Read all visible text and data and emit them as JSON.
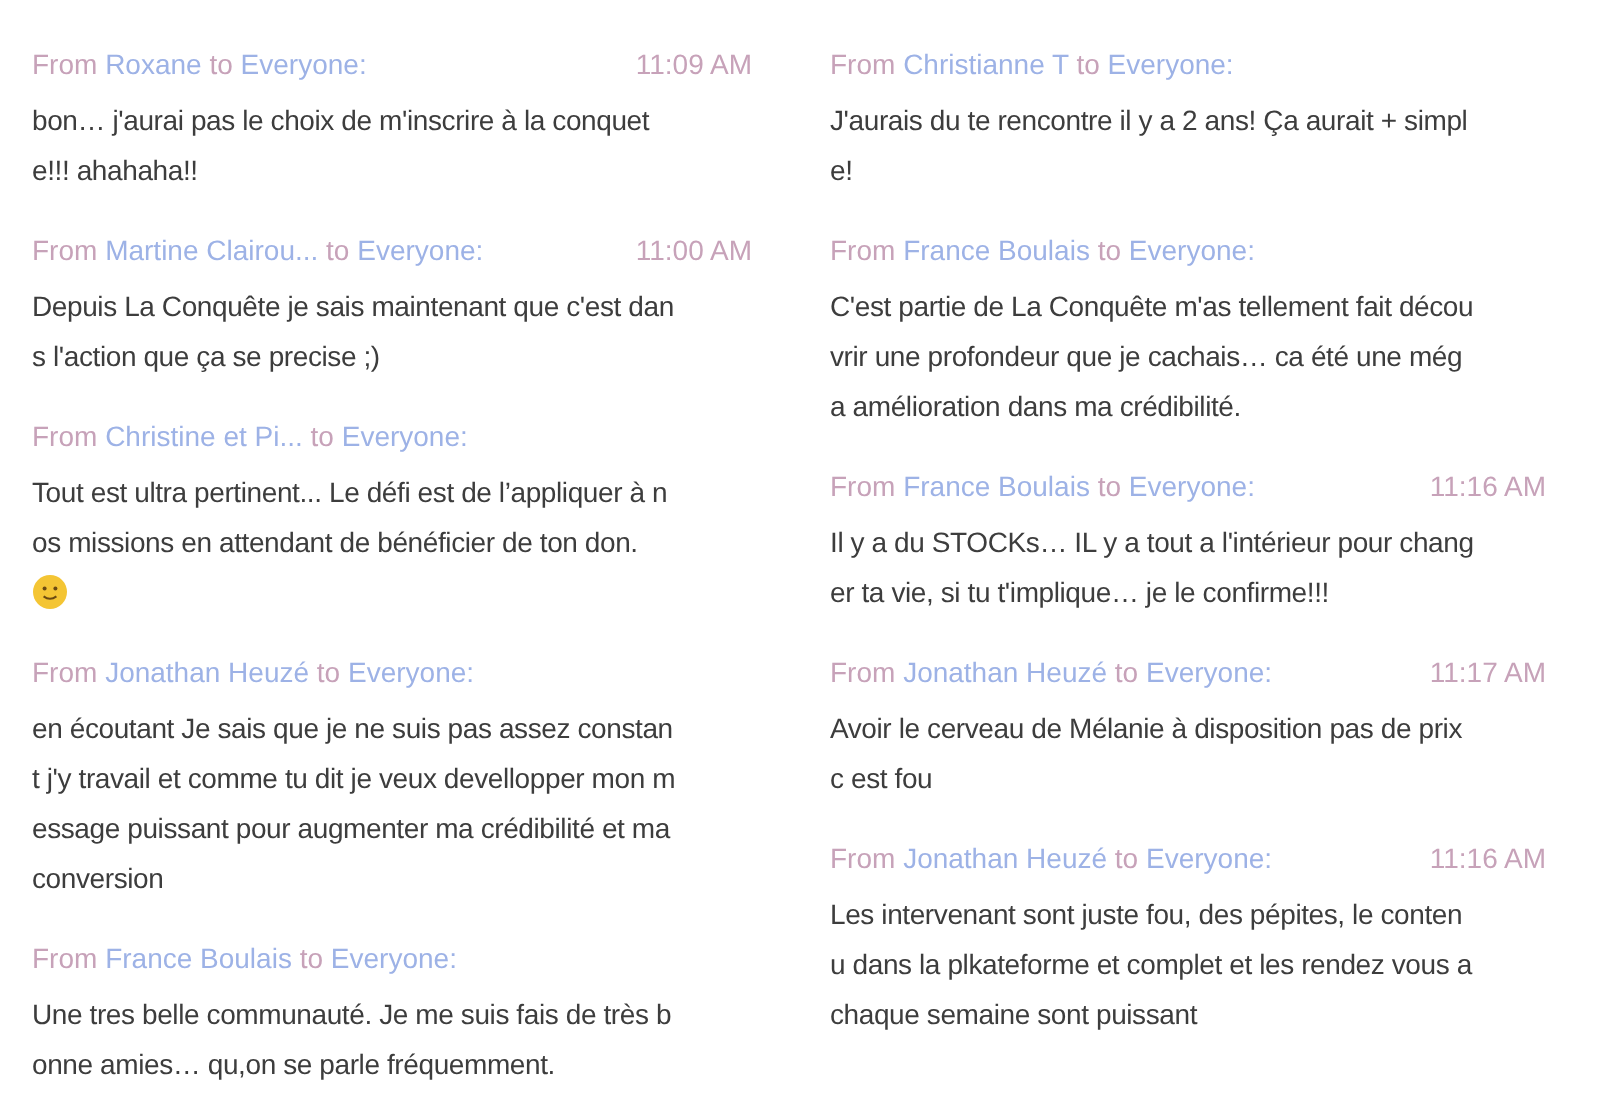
{
  "columns": [
    {
      "messages": [
        {
          "header": {
            "from_label": "From",
            "sender": "Roxane",
            "to_label": "to",
            "recipient": "Everyone:"
          },
          "time": "11:09 AM",
          "lines": [
            "bon… j'aurai pas le choix de m'inscrire à la conquet",
            "e!!! ahahaha!!"
          ]
        },
        {
          "header": {
            "from_label": "From",
            "sender": "Martine Clairou...",
            "to_label": "to",
            "recipient": "Everyone:"
          },
          "time": "11:00 AM",
          "lines": [
            "Depuis La Conquête je sais maintenant que c'est dan",
            "s l'action que ça se precise ;)"
          ]
        },
        {
          "header": {
            "from_label": "From",
            "sender": "Christine et Pi...",
            "to_label": "to",
            "recipient": "Everyone:"
          },
          "lines": [
            "Tout est ultra pertinent... Le défi est de l’appliquer à n",
            "os missions en attendant de bénéficier de ton don."
          ],
          "has_emoji": true
        },
        {
          "header": {
            "from_label": "From",
            "sender": "Jonathan Heuzé",
            "to_label": "to",
            "recipient": "Everyone:"
          },
          "lines": [
            "en écoutant Je sais que je ne suis pas assez constan",
            "t j'y travail et comme tu dit je veux devellopper mon m",
            "essage puissant pour augmenter ma crédibilité et ma",
            "conversion"
          ]
        },
        {
          "header": {
            "from_label": "From",
            "sender": "France Boulais",
            "to_label": "to",
            "recipient": "Everyone:"
          },
          "lines": [
            "Une tres belle communauté. Je me suis fais de très b",
            "onne amies… qu,on se parle fréquemment."
          ]
        }
      ]
    },
    {
      "messages": [
        {
          "header": {
            "from_label": "From",
            "sender": "Christianne T",
            "to_label": "to",
            "recipient": "Everyone:"
          },
          "lines": [
            "J'aurais du te rencontre il y a 2 ans! Ça aurait + simpl",
            "e!"
          ]
        },
        {
          "header": {
            "from_label": "From",
            "sender": "France Boulais",
            "to_label": "to",
            "recipient": "Everyone:"
          },
          "lines": [
            "C'est partie de La Conquête m'as tellement fait décou",
            "vrir une profondeur que je cachais… ca été une még",
            "a amélioration dans ma crédibilité."
          ]
        },
        {
          "header": {
            "from_label": "From",
            "sender": "France Boulais",
            "to_label": "to",
            "recipient": "Everyone:"
          },
          "time": "11:16 AM",
          "lines": [
            "Il y a du STOCKs… IL y a tout a l'intérieur pour chang",
            "er ta vie, si tu t'implique… je le confirme!!!"
          ]
        },
        {
          "header": {
            "from_label": "From",
            "sender": "Jonathan Heuzé",
            "to_label": "to",
            "recipient": "Everyone:"
          },
          "time": "11:17 AM",
          "lines": [
            "Avoir le cerveau de Mélanie à disposition pas de prix",
            "c est fou"
          ]
        },
        {
          "header": {
            "from_label": "From",
            "sender": "Jonathan Heuzé",
            "to_label": "to",
            "recipient": "Everyone:"
          },
          "time": "11:16 AM",
          "lines": [
            "Les intervenant sont juste fou, des pépites, le conten",
            "u dans la plkateforme et complet et les rendez vous a",
            "chaque semaine sont puissant"
          ]
        }
      ]
    }
  ]
}
